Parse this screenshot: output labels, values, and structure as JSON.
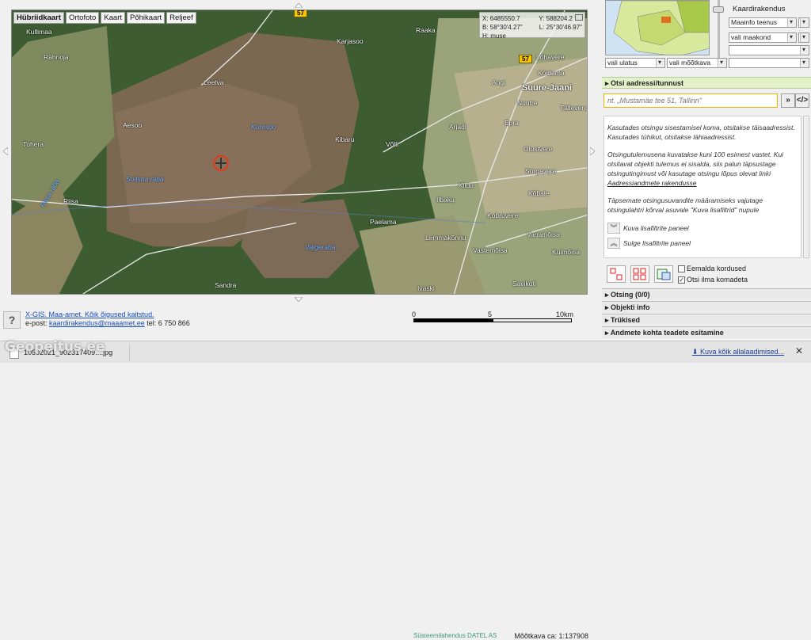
{
  "map": {
    "tabs": [
      "Hübriidkaart",
      "Ortofoto",
      "Kaart",
      "Põhikaart",
      "Reljeef"
    ],
    "active_tab": 0,
    "coords": {
      "x": "X: 6485550.7",
      "y": "Y: 588204.2",
      "b": "B: 58°30'4.27\"",
      "l": "L: 25°30'46.97\"",
      "h": "H: muse"
    },
    "places": [
      "Kullimaa",
      "Rähnoja",
      "Tohera",
      "Aesoo",
      "Riisa",
      "Leetva",
      "Karjasoo",
      "Kuresoo",
      "Kibaru",
      "Võlli",
      "Arjadi",
      "Suure-Jaani",
      "Nuutre",
      "Angi",
      "Epra",
      "Köidama",
      "Lõhavere",
      "Raaka",
      "Tällevere",
      "Olustvere",
      "Sürgavere",
      "Kildu",
      "Kõbale",
      "Ilbaku",
      "Paelama",
      "Lemmakõnnu",
      "Kobruvere",
      "Vanamõisa",
      "Vastemõisa",
      "Sandra",
      "Ivaski",
      "Savikoti",
      "Kuimõisa"
    ],
    "water_places": [
      "Suitsna raba",
      "Valgeraba",
      "Kuresoo",
      "Räsa raba"
    ],
    "road_numbers": [
      "57",
      "57"
    ]
  },
  "sidebar": {
    "kaardirakendus_title": "Kaardirakendus",
    "service_select": "Maainfo teenus",
    "county_select": "vali maakond",
    "extent_select": "vali ulatus",
    "scale_select": "vali mõõtkava",
    "search_header": "Otsi aadressi/tunnust",
    "search_placeholder": "nt. „Mustamäe tee 51, Tallinn\"",
    "help_p1": "Kasutades otsingu sisestamisel koma, otsitakse täisaadressist. Kasutades tühikut, otsitakse lähiaadressist.",
    "help_p2": "Otsingutulemusena kuvatakse kuni 100 esimest vastet. Kui otsitavat objekti tulemus ei sisalda, siis palun täpsustage otsingutingimust või kasutage otsingu lõpus olevat linki",
    "help_link": "Aadressiandmete rakendusse",
    "help_p3": "Täpsemate otsingusuvandite määramiseks vajutage otsingulahtri kõrval asuvale \"Kuva lisafiltrid\" nupule",
    "show_filters": "Kuva lisafiltrite paneel",
    "hide_filters": "Sulge lisafiltrite paneel",
    "remove_duplicates": "Eemalda kordused",
    "search_no_commas": "Otsi ilma komadeta",
    "accordions": [
      "Otsing (0/0)",
      "Objekti info",
      "Trükised",
      "Andmete kohta teadete esitamine"
    ]
  },
  "footer": {
    "copyright": "X-GIS. Maa-amet. Kõik õigused kaitstud.",
    "email_label": "e-post:",
    "email": "kaardirakendus@maaamet.ee",
    "phone": "tel: 6 750 866",
    "scale_labels": [
      "0",
      "5",
      "10km"
    ],
    "datel": "Süsteemilahendus DATEL AS",
    "scale_text": "Mõõtkava ca: 1:137908"
  },
  "downloads": {
    "file": "10502021_902317409....jpg",
    "show_all": "Kuva kõik allalaadimised...",
    "watermark": "Geopeitus.ee"
  }
}
